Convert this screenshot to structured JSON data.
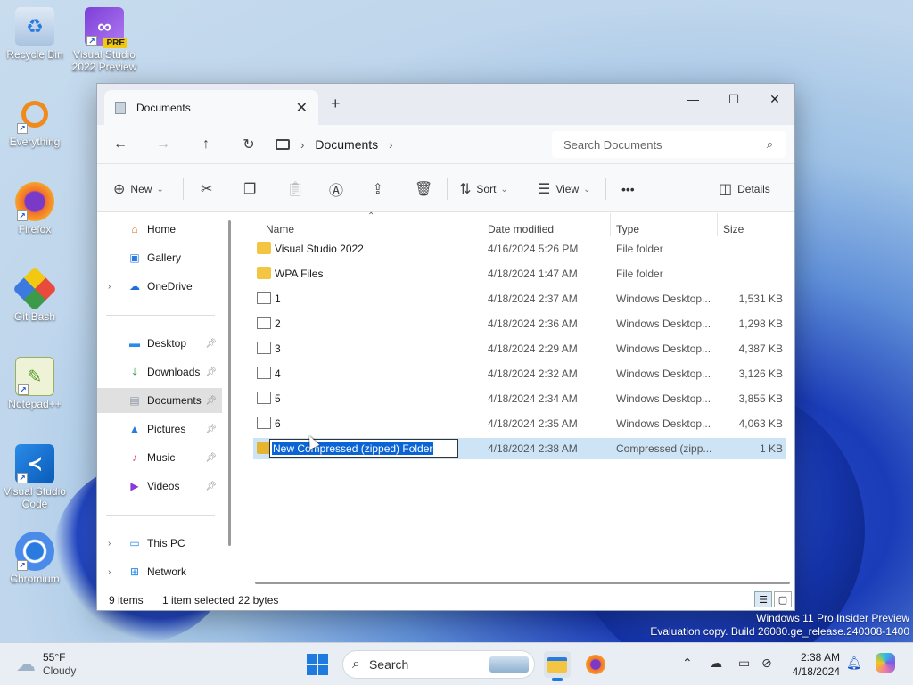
{
  "desktop": {
    "icons": [
      {
        "label": "Recycle Bin"
      },
      {
        "label": "Visual Studio 2022 Preview",
        "badge": "PRE"
      },
      {
        "label": "Everything"
      },
      {
        "label": "Firefox"
      },
      {
        "label": "Git Bash"
      },
      {
        "label": "Notepad++"
      },
      {
        "label": "Visual Studio Code"
      },
      {
        "label": "Chromium"
      }
    ]
  },
  "window": {
    "tab_title": "Documents",
    "tab_close": "✕",
    "new_tab": "+",
    "controls": {
      "minimize": "—",
      "maximize": "☐",
      "close": "✕"
    },
    "breadcrumb": {
      "current": "Documents"
    },
    "search_placeholder": "Search Documents",
    "toolbar": {
      "new_label": "New",
      "sort_label": "Sort",
      "view_label": "View",
      "more_label": "•••",
      "details_label": "Details"
    },
    "sidebar": {
      "home": "Home",
      "gallery": "Gallery",
      "onedrive": "OneDrive",
      "desktop": "Desktop",
      "downloads": "Downloads",
      "documents": "Documents",
      "pictures": "Pictures",
      "music": "Music",
      "videos": "Videos",
      "thispc": "This PC",
      "network": "Network"
    },
    "columns": {
      "name": "Name",
      "date": "Date modified",
      "type": "Type",
      "size": "Size"
    },
    "files": [
      {
        "name": "Visual Studio 2022",
        "date": "4/16/2024 5:26 PM",
        "type": "File folder",
        "size": ""
      },
      {
        "name": "WPA Files",
        "date": "4/18/2024 1:47 AM",
        "type": "File folder",
        "size": ""
      },
      {
        "name": "1",
        "date": "4/18/2024 2:37 AM",
        "type": "Windows Desktop...",
        "size": "1,531 KB"
      },
      {
        "name": "2",
        "date": "4/18/2024 2:36 AM",
        "type": "Windows Desktop...",
        "size": "1,298 KB"
      },
      {
        "name": "3",
        "date": "4/18/2024 2:29 AM",
        "type": "Windows Desktop...",
        "size": "4,387 KB"
      },
      {
        "name": "4",
        "date": "4/18/2024 2:32 AM",
        "type": "Windows Desktop...",
        "size": "3,126 KB"
      },
      {
        "name": "5",
        "date": "4/18/2024 2:34 AM",
        "type": "Windows Desktop...",
        "size": "3,855 KB"
      },
      {
        "name": "6",
        "date": "4/18/2024 2:35 AM",
        "type": "Windows Desktop...",
        "size": "4,063 KB"
      },
      {
        "name": "New Compressed (zipped) Folder",
        "date": "4/18/2024 2:38 AM",
        "type": "Compressed (zipp...",
        "size": "1 KB"
      }
    ],
    "status": {
      "count": "9 items",
      "selected": "1 item selected",
      "bytes": "22 bytes"
    }
  },
  "watermark": {
    "line1": "Windows 11 Pro Insider Preview",
    "line2": "Evaluation copy. Build 26080.ge_release.240308-1400"
  },
  "taskbar": {
    "weather_temp": "55°F",
    "weather_desc": "Cloudy",
    "search_label": "Search",
    "time": "2:38 AM",
    "date": "4/18/2024"
  },
  "colors": {
    "accent": "#1f7ae0",
    "selection": "#cde4f7",
    "folder": "#f4c542"
  }
}
